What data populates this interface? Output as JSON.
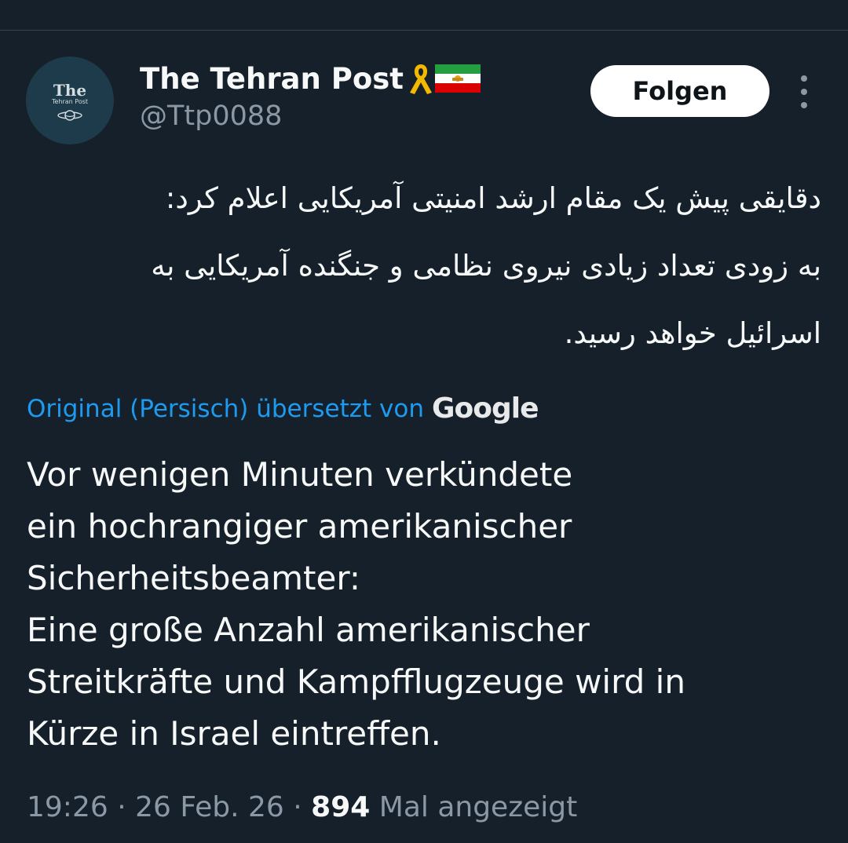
{
  "author": {
    "avatar_text": "The",
    "avatar_subtext": "Tehran Post",
    "display_name": "The Tehran Post",
    "handle": "@Ttp0088"
  },
  "follow_label": "Folgen",
  "tweet": {
    "original_lines": [
      "دقایقی پیش یک مقام ارشد امنیتی آمریکایی اعلام کرد:",
      "به زودی تعداد زیادی نیروی نظامی و جنگنده آمریکایی به",
      "اسرائیل خواهد رسید."
    ],
    "translation_label": "Original (Persisch) übersetzt von",
    "translation_provider": "Google",
    "translated_lines": [
      "Vor wenigen Minuten verkündete",
      "ein hochrangiger amerikanischer",
      "Sicherheitsbeamter:",
      "Eine große Anzahl amerikanischer",
      "Streitkräfte und Kampfflugzeuge wird in",
      "Kürze in Israel eintreffen."
    ]
  },
  "meta": {
    "time": "19:26",
    "date": "26 Feb. 26",
    "separator": "·",
    "views_count": "894",
    "views_label": "Mal angezeigt"
  },
  "colors": {
    "background": "#15202b",
    "text": "#f7f9f9",
    "secondary_text": "#8b98a5",
    "link": "#1d9bf0"
  }
}
